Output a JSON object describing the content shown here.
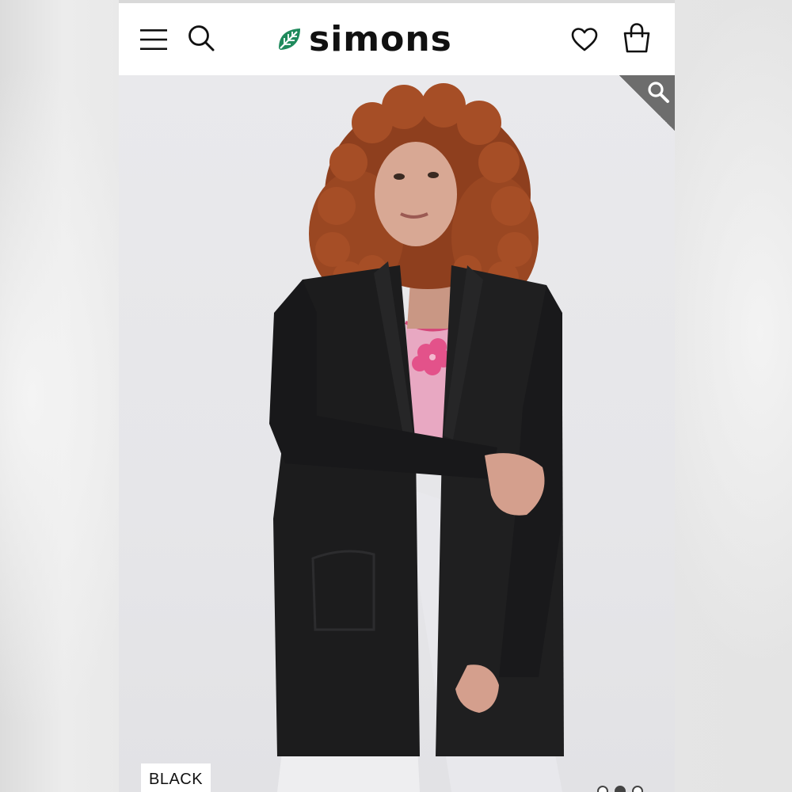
{
  "header": {
    "logo_text": "simons",
    "icons": {
      "menu": "hamburger-menu-icon",
      "search": "search-icon",
      "logo_mark": "leaf-icon",
      "favorites": "heart-icon",
      "bag": "shopping-bag-icon",
      "zoom": "zoom-magnifier-icon"
    }
  },
  "product_image": {
    "color_label": "BLACK",
    "gallery_dots": {
      "count": 3,
      "active_index": 1
    }
  },
  "colors": {
    "brand_green": "#1f8a5c",
    "icon": "#111111",
    "zoom_corner": "#6d6d6d",
    "cardigan": "#1c1c1d",
    "hair": "#9a4722",
    "top_pink": "#e8a8c2"
  }
}
